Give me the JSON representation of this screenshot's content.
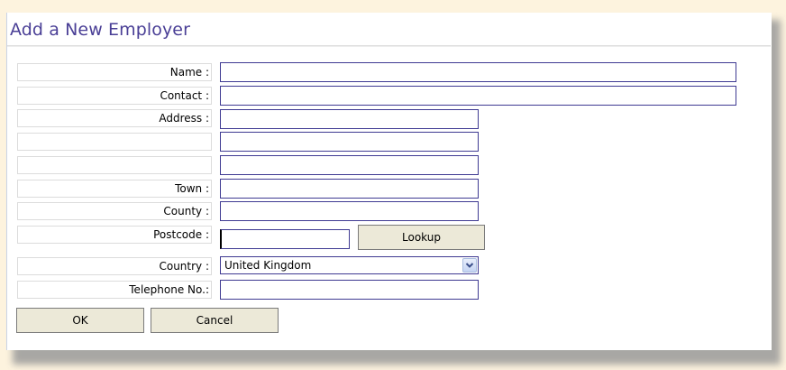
{
  "form": {
    "title": "Add a New Employer",
    "labels": {
      "name": "Name :",
      "contact": "Contact :",
      "address": "Address :",
      "address2": "",
      "address3": "",
      "town": "Town :",
      "county": "County :",
      "postcode": "Postcode :",
      "country": "Country :",
      "telephone": "Telephone No.:"
    },
    "values": {
      "name": "",
      "contact": "",
      "address1": "",
      "address2": "",
      "address3": "",
      "town": "",
      "county": "",
      "postcode": "",
      "country": "United Kingdom",
      "telephone": ""
    },
    "buttons": {
      "lookup": "Lookup",
      "ok": "OK",
      "cancel": "Cancel"
    }
  },
  "icons": {
    "country_dropdown": "chevron-down-icon"
  },
  "colors": {
    "page_background": "#fdf3de",
    "title": "#4a3f96",
    "field_border": "#3f3a92",
    "button_background": "#ece9d8"
  }
}
